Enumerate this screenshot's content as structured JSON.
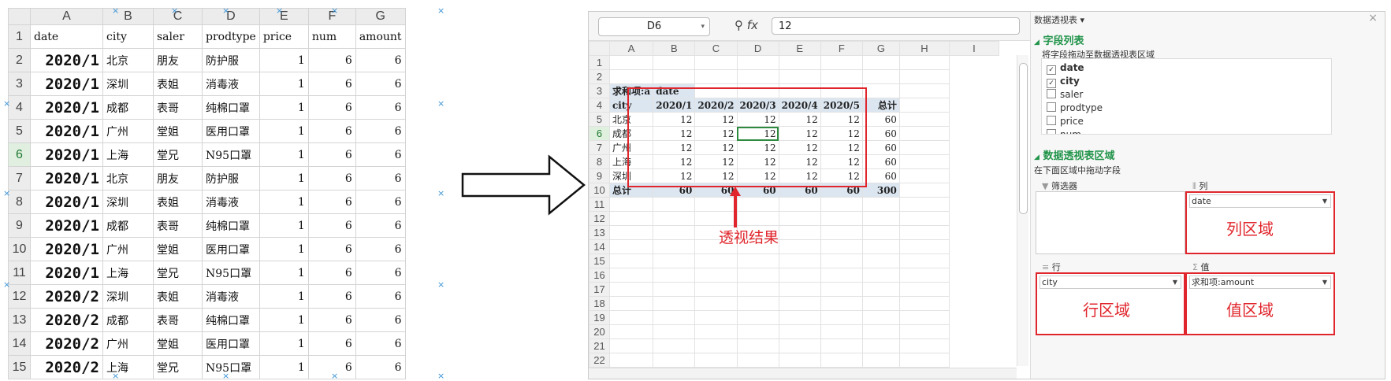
{
  "left_sheet": {
    "columns": [
      "A",
      "B",
      "C",
      "D",
      "E",
      "F",
      "G"
    ],
    "rows": [
      {
        "n": "1",
        "cells": [
          "date",
          "city",
          "saler",
          "prodtype",
          "price",
          "num",
          "amount"
        ]
      },
      {
        "n": "2",
        "cells": [
          "2020/1",
          "北京",
          "朋友",
          "防护服",
          "1",
          "6",
          "6"
        ]
      },
      {
        "n": "3",
        "cells": [
          "2020/1",
          "深圳",
          "表姐",
          "消毒液",
          "1",
          "6",
          "6"
        ]
      },
      {
        "n": "4",
        "cells": [
          "2020/1",
          "成都",
          "表哥",
          "纯棉口罩",
          "1",
          "6",
          "6"
        ]
      },
      {
        "n": "5",
        "cells": [
          "2020/1",
          "广州",
          "堂姐",
          "医用口罩",
          "1",
          "6",
          "6"
        ]
      },
      {
        "n": "6",
        "cells": [
          "2020/1",
          "上海",
          "堂兄",
          "N95口罩",
          "1",
          "6",
          "6"
        ]
      },
      {
        "n": "7",
        "cells": [
          "2020/1",
          "北京",
          "朋友",
          "防护服",
          "1",
          "6",
          "6"
        ]
      },
      {
        "n": "8",
        "cells": [
          "2020/1",
          "深圳",
          "表姐",
          "消毒液",
          "1",
          "6",
          "6"
        ]
      },
      {
        "n": "9",
        "cells": [
          "2020/1",
          "成都",
          "表哥",
          "纯棉口罩",
          "1",
          "6",
          "6"
        ]
      },
      {
        "n": "10",
        "cells": [
          "2020/1",
          "广州",
          "堂姐",
          "医用口罩",
          "1",
          "6",
          "6"
        ]
      },
      {
        "n": "11",
        "cells": [
          "2020/1",
          "上海",
          "堂兄",
          "N95口罩",
          "1",
          "6",
          "6"
        ]
      },
      {
        "n": "12",
        "cells": [
          "2020/2",
          "深圳",
          "表姐",
          "消毒液",
          "1",
          "6",
          "6"
        ]
      },
      {
        "n": "13",
        "cells": [
          "2020/2",
          "成都",
          "表哥",
          "纯棉口罩",
          "1",
          "6",
          "6"
        ]
      },
      {
        "n": "14",
        "cells": [
          "2020/2",
          "广州",
          "堂姐",
          "医用口罩",
          "1",
          "6",
          "6"
        ]
      },
      {
        "n": "15",
        "cells": [
          "2020/2",
          "上海",
          "堂兄",
          "N95口罩",
          "1",
          "6",
          "6"
        ]
      }
    ]
  },
  "right_sheet": {
    "name_box": "D6",
    "formula_value": "12",
    "fx_label": "fx",
    "columns": [
      "A",
      "B",
      "C",
      "D",
      "E",
      "F",
      "G",
      "H",
      "I"
    ],
    "row_numbers": [
      "1",
      "2",
      "3",
      "4",
      "5",
      "6",
      "7",
      "8",
      "9",
      "10",
      "11",
      "12",
      "13",
      "14",
      "15",
      "16",
      "17",
      "18",
      "19",
      "20",
      "21",
      "22"
    ],
    "pivot": {
      "filter_label": "求和项:a",
      "filter_field": "date",
      "row_field": "city",
      "headers": [
        "2020/1",
        "2020/2",
        "2020/3",
        "2020/4",
        "2020/5",
        "总计"
      ],
      "rows": [
        {
          "label": "北京",
          "values": [
            "12",
            "12",
            "12",
            "12",
            "12",
            "60"
          ]
        },
        {
          "label": "成都",
          "values": [
            "12",
            "12",
            "12",
            "12",
            "12",
            "60"
          ]
        },
        {
          "label": "广州",
          "values": [
            "12",
            "12",
            "12",
            "12",
            "12",
            "60"
          ]
        },
        {
          "label": "上海",
          "values": [
            "12",
            "12",
            "12",
            "12",
            "12",
            "60"
          ]
        },
        {
          "label": "深圳",
          "values": [
            "12",
            "12",
            "12",
            "12",
            "12",
            "60"
          ]
        }
      ],
      "total_label": "总计",
      "totals": [
        "60",
        "60",
        "60",
        "60",
        "60",
        "300"
      ]
    },
    "annotation": "透视结果"
  },
  "panel": {
    "title": "数据透视表",
    "field_list_heading": "字段列表",
    "field_list_hint": "将字段拖动至数据透视表区域",
    "fields": [
      {
        "name": "date",
        "checked": true
      },
      {
        "name": "city",
        "checked": true
      },
      {
        "name": "saler",
        "checked": false
      },
      {
        "name": "prodtype",
        "checked": false
      },
      {
        "name": "price",
        "checked": false
      },
      {
        "name": "num",
        "checked": false
      }
    ],
    "area_heading": "数据透视表区域",
    "area_hint": "在下面区域中拖动字段",
    "filter_zone_label": "筛选器",
    "column_zone_label": "列",
    "row_zone_label": "行",
    "value_zone_label": "值",
    "column_zone_value": "date",
    "row_zone_value": "city",
    "value_zone_value": "求和项:amount",
    "column_zone_note": "列区域",
    "row_zone_note": "行区域",
    "value_zone_note": "值区域"
  }
}
